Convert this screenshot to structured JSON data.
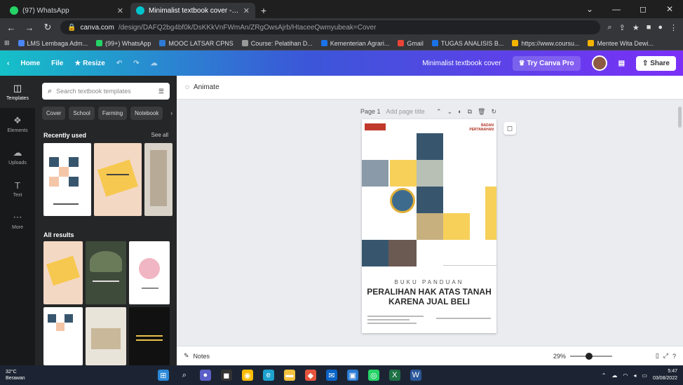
{
  "browser": {
    "tabs": [
      {
        "title": "(97) WhatsApp",
        "favicon_color": "#25d366",
        "active": false
      },
      {
        "title": "Minimalist textbook cover - eBo",
        "favicon_color": "#00c4cc",
        "active": true
      }
    ],
    "new_tab": "+",
    "window_controls": [
      "⌄",
      "—",
      "◻",
      "✕"
    ],
    "url_host": "canva.com",
    "url_path": "/design/DAFQ2bg4bf0k/DsKKkVnFWmAn/ZRgOwsAjrb/HtaceeQwmyubeak=Cover",
    "bookmarks": [
      {
        "label": "LMS Lembaga Adm...",
        "color": "#4a86f5"
      },
      {
        "label": "(99+) WhatsApp",
        "color": "#25d366"
      },
      {
        "label": "MOOC LATSAR CPNS",
        "color": "#2e7bd6"
      },
      {
        "label": "Course: Pelatihan D...",
        "color": "#999999"
      },
      {
        "label": "Kementerian Agrari...",
        "color": "#1a73e8"
      },
      {
        "label": "Gmail",
        "color": "#ea4335"
      },
      {
        "label": "TUGAS ANALISIS B...",
        "color": "#1a73e8"
      },
      {
        "label": "https://www.coursu...",
        "color": "#f4b400"
      },
      {
        "label": "Mentee Wita Dewi...",
        "color": "#f4b400"
      }
    ]
  },
  "canva_header": {
    "home": "Home",
    "file": "File",
    "resize": "Resize",
    "design_title": "Minimalist textbook cover",
    "try_pro": "Try Canva Pro",
    "share": "Share"
  },
  "rail": [
    {
      "label": "Templates",
      "icon": "◫"
    },
    {
      "label": "Elements",
      "icon": "❖"
    },
    {
      "label": "Uploads",
      "icon": "☁"
    },
    {
      "label": "Text",
      "icon": "T"
    },
    {
      "label": "More",
      "icon": "⋯"
    }
  ],
  "panel": {
    "search_placeholder": "Search textbook templates",
    "chips": [
      "Cover",
      "School",
      "Farming",
      "Notebook"
    ],
    "recently_used": "Recently used",
    "see_all": "See all",
    "all_results": "All results"
  },
  "workspace": {
    "animate": "Animate",
    "page_label": "Page 1",
    "page_title_placeholder": "Add page title",
    "notes": "Notes",
    "zoom": "29%"
  },
  "cover": {
    "top_right_logo": "BADAN PERTANAHAN",
    "line1": "BUKU PANDUAN",
    "line2": "PERALIHAN HAK ATAS TANAH",
    "line3": "KARENA JUAL BELI",
    "colors": {
      "navy": "#37566e",
      "yellow": "#f7d05a"
    }
  },
  "taskbar": {
    "temperature": "32°C",
    "weather": "Berawan",
    "time": "5:47",
    "date": "03/08/2022"
  }
}
